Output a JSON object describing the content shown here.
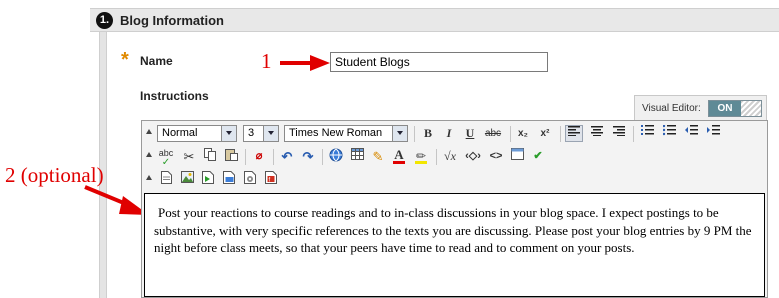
{
  "section": {
    "step_number": "1.",
    "title": "Blog Information"
  },
  "name_field": {
    "required_marker": "*",
    "label": "Name",
    "value": "Student Blogs"
  },
  "instructions_field": {
    "label": "Instructions"
  },
  "annotations": {
    "name_callout": "1",
    "editor_callout": "2 (optional)",
    "color": "#e00000"
  },
  "visual_editor": {
    "label": "Visual Editor:",
    "state": "ON"
  },
  "toolbar": {
    "row1": {
      "format": "Normal",
      "size": "3",
      "font": "Times New Roman",
      "bold": "B",
      "italic": "I",
      "underline": "U",
      "strike": "abc",
      "subscript": "x₂",
      "superscript": "x²"
    },
    "row2": {
      "spellcheck": "abc"
    }
  },
  "editor_content": "Post your reactions to course readings and to in-class discussions in your blog space.  I expect postings to be substantive, with very specific references to the texts you are discussing.  Please post your blog entries by 9 PM the night before class meets, so that your peers have time to read and to comment on your posts.",
  "colors": {
    "header_bg": "#e8e8e8",
    "accent_toggle": "#5f8a96",
    "required_star": "#e08a00"
  }
}
